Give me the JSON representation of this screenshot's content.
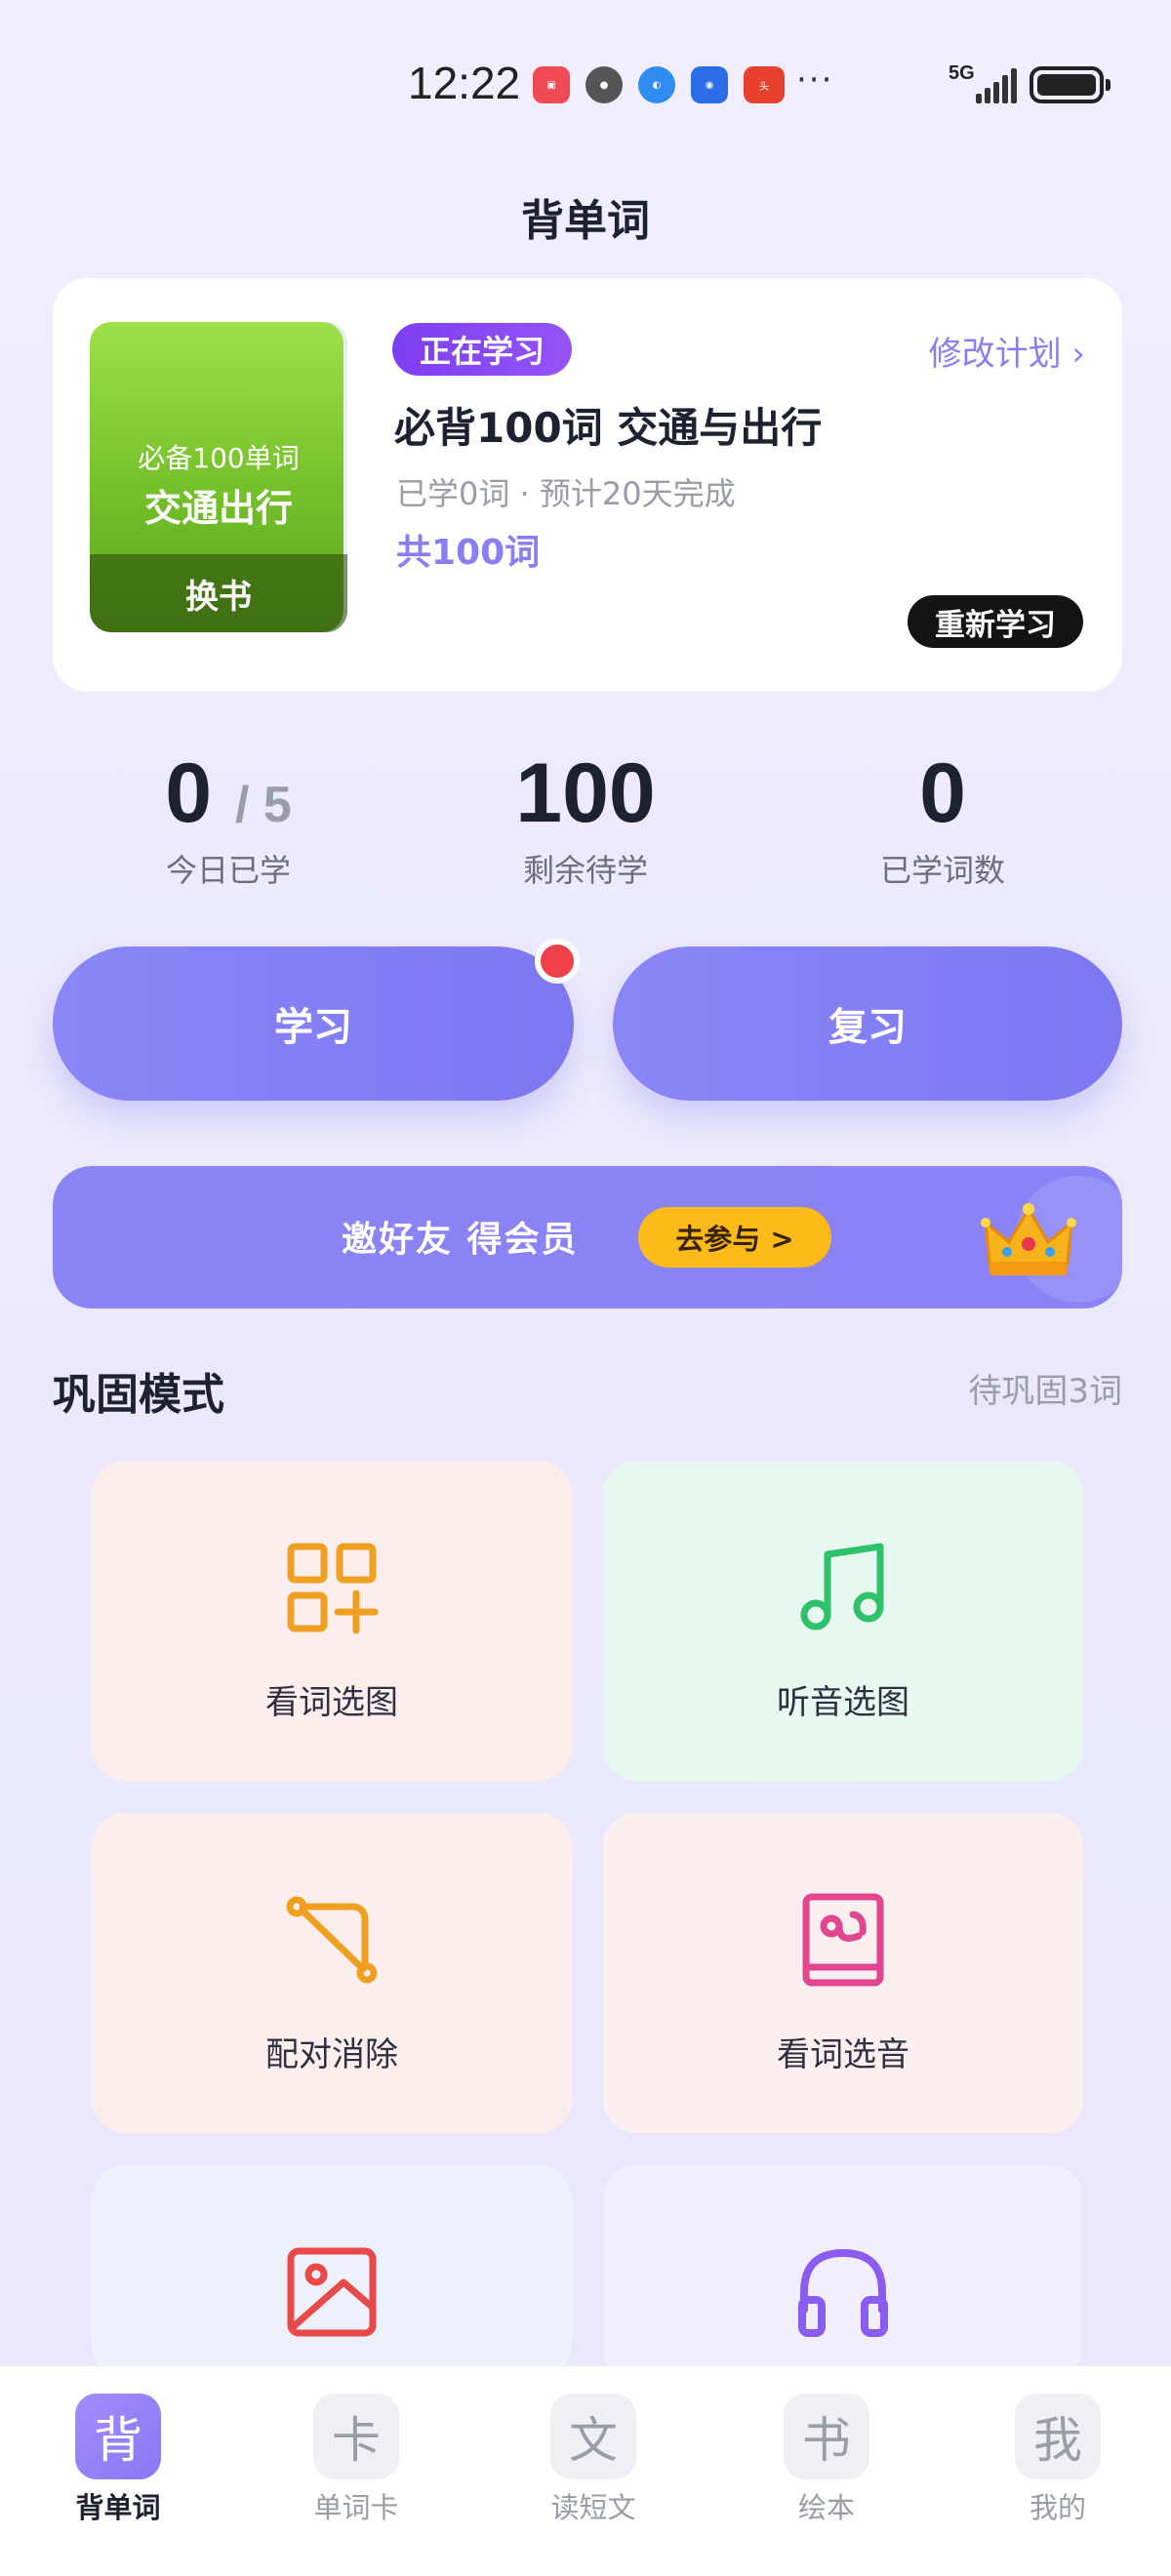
{
  "status_bar": {
    "time": "12:22",
    "network": "5G",
    "icons": [
      "huawei-store-icon",
      "avatar-app-icon",
      "browser-icon",
      "assistant-icon",
      "toutiao-icon"
    ],
    "more": "···"
  },
  "header": {
    "title": "背单词"
  },
  "plan": {
    "book_subtitle": "必备100单词",
    "book_title": "交通出行",
    "change_book": "换书",
    "badge": "正在学习",
    "modify_label": "修改计划 ›",
    "name": "必背100词 交通与出行",
    "meta": "已学0词 · 预计20天完成",
    "total": "共100词",
    "relearn": "重新学习"
  },
  "stats": {
    "today_value": "0",
    "today_goal": "/ 5",
    "today_label": "今日已学",
    "remaining_value": "100",
    "remaining_label": "剩余待学",
    "learned_value": "0",
    "learned_label": "已学词数"
  },
  "actions": {
    "study": "学习",
    "review": "复习"
  },
  "invite": {
    "text": "邀好友 得会员",
    "button": "去参与 >"
  },
  "modes": {
    "title": "巩固模式",
    "pending": "待巩固3词",
    "tiles": [
      {
        "label": "看词选图",
        "icon": "apps-icon",
        "color": "#f0a020"
      },
      {
        "label": "听音选图",
        "icon": "music-note-icon",
        "color": "#2ec26a"
      },
      {
        "label": "配对消除",
        "icon": "match-line-icon",
        "color": "#f0a020"
      },
      {
        "label": "看词选音",
        "icon": "audio-book-icon",
        "color": "#e2468e"
      },
      {
        "label": "",
        "icon": "image-icon",
        "color": "#e84a4a"
      },
      {
        "label": "",
        "icon": "headphones-icon",
        "color": "#8a5cf0"
      }
    ]
  },
  "nav": {
    "items": [
      {
        "glyph": "背",
        "label": "背单词",
        "active": true
      },
      {
        "glyph": "卡",
        "label": "单词卡",
        "active": false
      },
      {
        "glyph": "文",
        "label": "读短文",
        "active": false
      },
      {
        "glyph": "书",
        "label": "绘本",
        "active": false
      },
      {
        "glyph": "我",
        "label": "我的",
        "active": false
      }
    ]
  }
}
